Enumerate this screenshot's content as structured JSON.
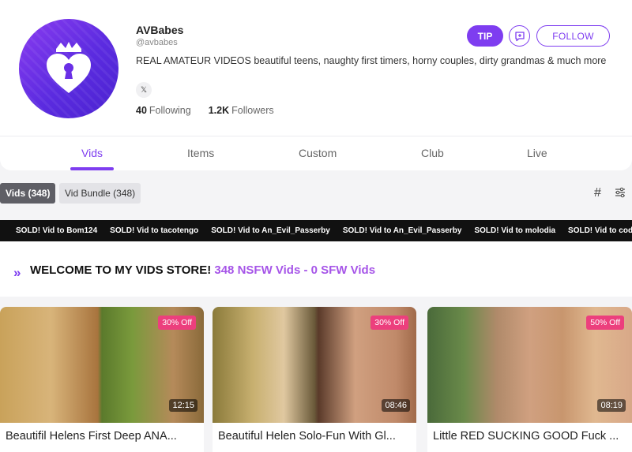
{
  "profile": {
    "name": "AVBabes",
    "handle": "@avbabes",
    "bio": "REAL AMATEUR VIDEOS beautiful teens, naughty first timers, horny couples, dirty grandmas & much more",
    "social_icon": "x-icon",
    "social_label": "𝕏",
    "following_count": "40",
    "following_label": "Following",
    "followers_count": "1.2K",
    "followers_label": "Followers"
  },
  "actions": {
    "tip_label": "TIP",
    "follow_label": "FOLLOW"
  },
  "tabs": [
    {
      "label": "Vids",
      "active": true
    },
    {
      "label": "Items",
      "active": false
    },
    {
      "label": "Custom",
      "active": false
    },
    {
      "label": "Club",
      "active": false
    },
    {
      "label": "Live",
      "active": false
    }
  ],
  "filters": [
    {
      "label": "Vids (348)",
      "active": true
    },
    {
      "label": "Vid Bundle (348)",
      "active": false
    }
  ],
  "ticker": [
    "SOLD! Vid to Bom124",
    "SOLD! Vid to tacotengo",
    "SOLD! Vid to An_Evil_Passerby",
    "SOLD! Vid to An_Evil_Passerby",
    "SOLD! Vid to molodia",
    "SOLD! Vid to codyrhodes"
  ],
  "welcome": {
    "chevron": "»",
    "heading": "WELCOME TO MY VIDS STORE!",
    "counts": "348 NSFW Vids - 0 SFW Vids"
  },
  "videos": [
    {
      "title": "Beautifil Helens First Deep ANA...",
      "discount": "30% Off",
      "duration": "12:15"
    },
    {
      "title": "Beautiful Helen Solo-Fun With Gl...",
      "discount": "30% Off",
      "duration": "08:46"
    },
    {
      "title": "Little RED SUCKING GOOD Fuck ...",
      "discount": "50% Off",
      "duration": "08:19"
    }
  ],
  "colors": {
    "accent": "#7e3df0",
    "discount": "#ec3f7d",
    "welcome_count": "#a655e8"
  }
}
